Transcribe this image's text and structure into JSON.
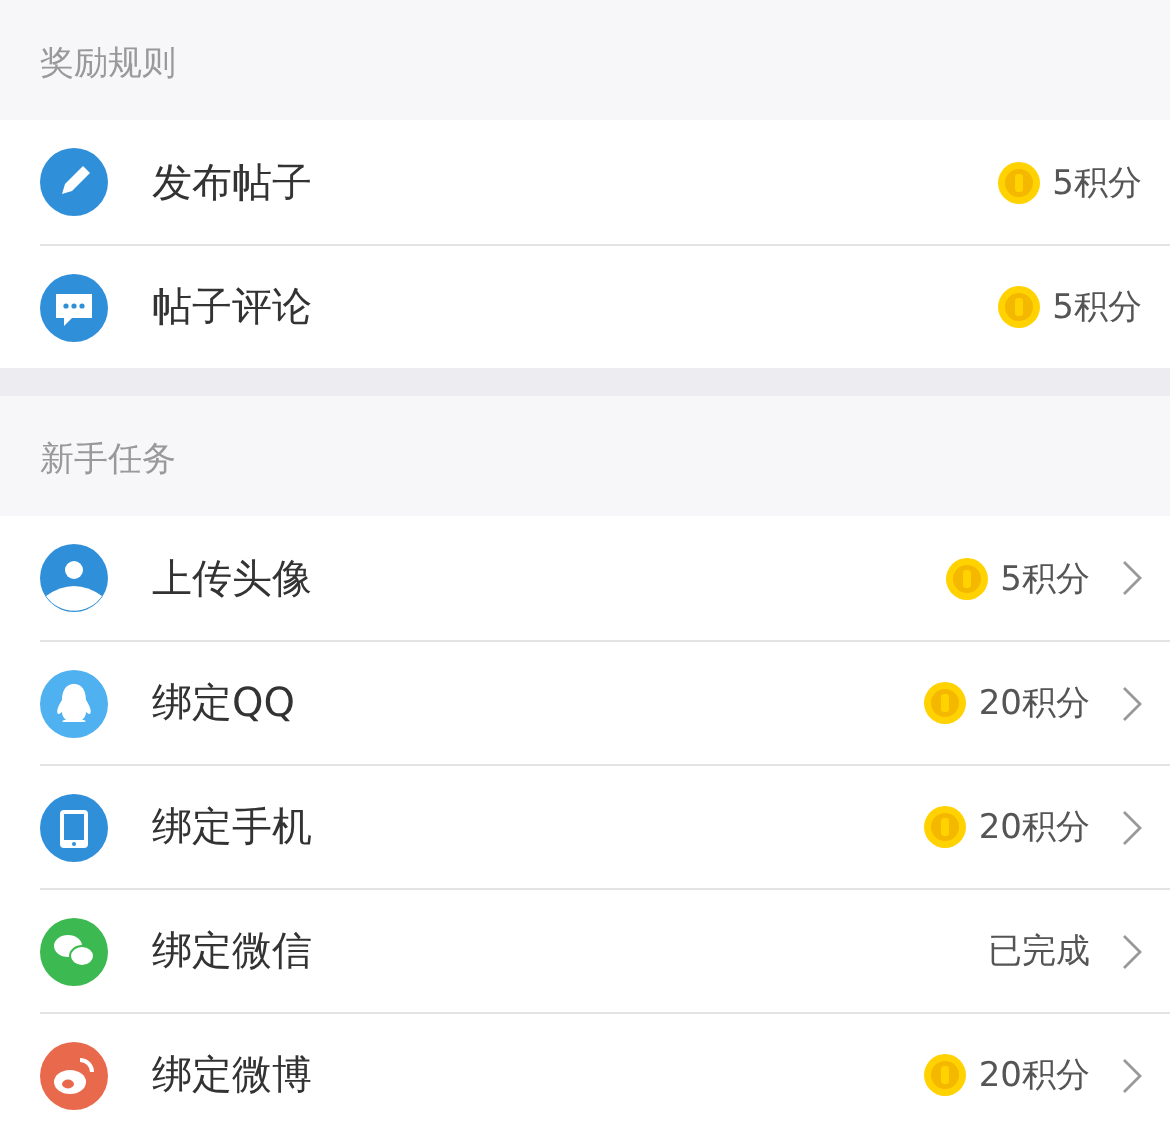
{
  "sections": [
    {
      "title": "奖励规则",
      "items": [
        {
          "label": "发布帖子",
          "kind": "points",
          "reward": "5积分"
        },
        {
          "label": "帖子评论",
          "kind": "points",
          "reward": "5积分"
        }
      ]
    },
    {
      "title": "新手任务",
      "items": [
        {
          "label": "上传头像",
          "kind": "points",
          "reward": "5积分",
          "chevron": true
        },
        {
          "label": "绑定QQ",
          "kind": "points",
          "reward": "20积分",
          "chevron": true
        },
        {
          "label": "绑定手机",
          "kind": "points",
          "reward": "20积分",
          "chevron": true
        },
        {
          "label": "绑定微信",
          "kind": "done",
          "reward": "已完成",
          "chevron": true
        },
        {
          "label": "绑定微博",
          "kind": "points",
          "reward": "20积分",
          "chevron": true
        }
      ]
    }
  ]
}
